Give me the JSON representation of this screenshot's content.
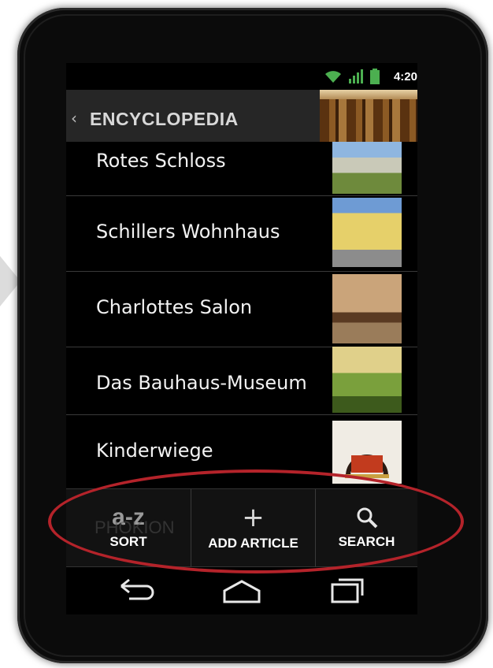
{
  "status_bar": {
    "time": "4:20",
    "icons": [
      "wifi-icon",
      "signal-icon",
      "battery-icon"
    ],
    "accent": "#4caf50"
  },
  "action_bar": {
    "title": "ENCYCLOPEDIA"
  },
  "list": {
    "items": [
      {
        "label": "Rotes Schloss",
        "thumb": "rotes-schloss-thumbnail"
      },
      {
        "label": "Schillers Wohnhaus",
        "thumb": "schillers-wohnhaus-thumbnail"
      },
      {
        "label": "Charlottes Salon",
        "thumb": "charlottes-salon-thumbnail"
      },
      {
        "label": "Das Bauhaus-Museum",
        "thumb": "bauhaus-museum-thumbnail"
      },
      {
        "label": "Kinderwiege",
        "thumb": "kinderwiege-thumbnail"
      },
      {
        "label": "PHOKION",
        "thumb": "phokion-thumbnail"
      }
    ]
  },
  "bottom_bar": {
    "sort_icon_text": "a-z",
    "sort_label": "SORT",
    "add_label": "ADD ARTICLE",
    "search_label": "SEARCH"
  },
  "highlight_color": "#b4232a"
}
